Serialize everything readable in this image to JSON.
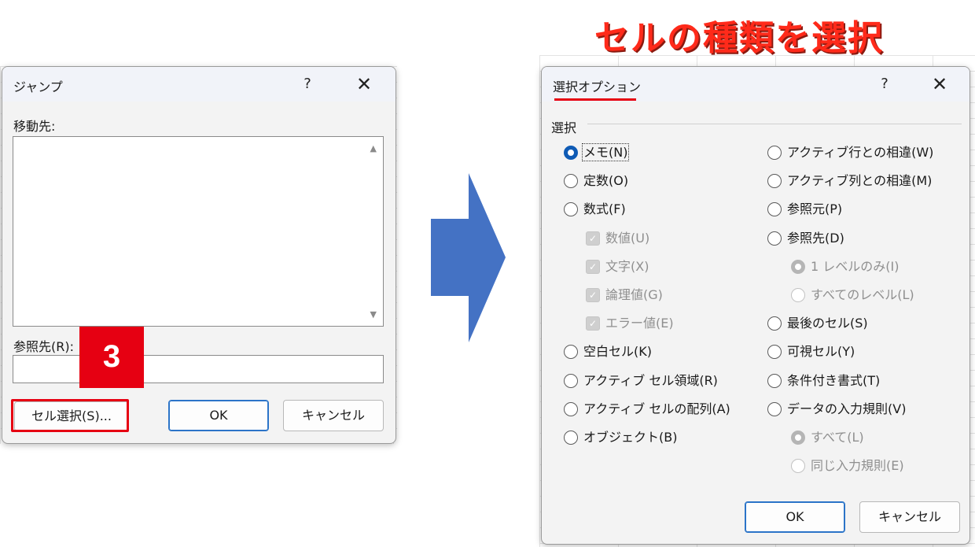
{
  "headline": "セルの種類を選択",
  "jump_dialog": {
    "title": "ジャンプ",
    "help": "?",
    "close": "✕",
    "goto_label": "移動先:",
    "ref_label": "参照先(R):",
    "cell_select_button": "セル選択(S)...",
    "ok_button": "OK",
    "cancel_button": "キャンセル",
    "step_badge": "3"
  },
  "options_dialog": {
    "title": "選択オプション",
    "help": "?",
    "close": "✕",
    "group_label": "選択",
    "left_options": [
      {
        "label": "メモ(N)",
        "type": "radio",
        "checked": true,
        "disabled": false
      },
      {
        "label": "定数(O)",
        "type": "radio",
        "checked": false,
        "disabled": false
      },
      {
        "label": "数式(F)",
        "type": "radio",
        "checked": false,
        "disabled": false
      },
      {
        "label": "数値(U)",
        "type": "checkbox",
        "checked": true,
        "disabled": true
      },
      {
        "label": "文字(X)",
        "type": "checkbox",
        "checked": true,
        "disabled": true
      },
      {
        "label": "論理値(G)",
        "type": "checkbox",
        "checked": true,
        "disabled": true
      },
      {
        "label": "エラー値(E)",
        "type": "checkbox",
        "checked": true,
        "disabled": true
      },
      {
        "label": "空白セル(K)",
        "type": "radio",
        "checked": false,
        "disabled": false
      },
      {
        "label": "アクティブ セル領域(R)",
        "type": "radio",
        "checked": false,
        "disabled": false
      },
      {
        "label": "アクティブ セルの配列(A)",
        "type": "radio",
        "checked": false,
        "disabled": false
      },
      {
        "label": "オブジェクト(B)",
        "type": "radio",
        "checked": false,
        "disabled": false
      }
    ],
    "right_options": [
      {
        "label": "アクティブ行との相違(W)",
        "type": "radio",
        "checked": false,
        "disabled": false
      },
      {
        "label": "アクティブ列との相違(M)",
        "type": "radio",
        "checked": false,
        "disabled": false
      },
      {
        "label": "参照元(P)",
        "type": "radio",
        "checked": false,
        "disabled": false
      },
      {
        "label": "参照先(D)",
        "type": "radio",
        "checked": false,
        "disabled": false
      },
      {
        "label": "1 レベルのみ(I)",
        "type": "radio",
        "checked": true,
        "disabled": true
      },
      {
        "label": "すべてのレベル(L)",
        "type": "radio",
        "checked": false,
        "disabled": true
      },
      {
        "label": "最後のセル(S)",
        "type": "radio",
        "checked": false,
        "disabled": false
      },
      {
        "label": "可視セル(Y)",
        "type": "radio",
        "checked": false,
        "disabled": false
      },
      {
        "label": "条件付き書式(T)",
        "type": "radio",
        "checked": false,
        "disabled": false
      },
      {
        "label": "データの入力規則(V)",
        "type": "radio",
        "checked": false,
        "disabled": false
      },
      {
        "label": "すべて(L)",
        "type": "radio",
        "checked": true,
        "disabled": true
      },
      {
        "label": "同じ入力規則(E)",
        "type": "radio",
        "checked": false,
        "disabled": true
      }
    ],
    "ok_button": "OK",
    "cancel_button": "キャンセル"
  },
  "colors": {
    "accent_red": "#e60012",
    "headline_red": "#ff2a1a",
    "arrow_blue": "#4472c4",
    "radio_blue": "#0f5bb5"
  }
}
